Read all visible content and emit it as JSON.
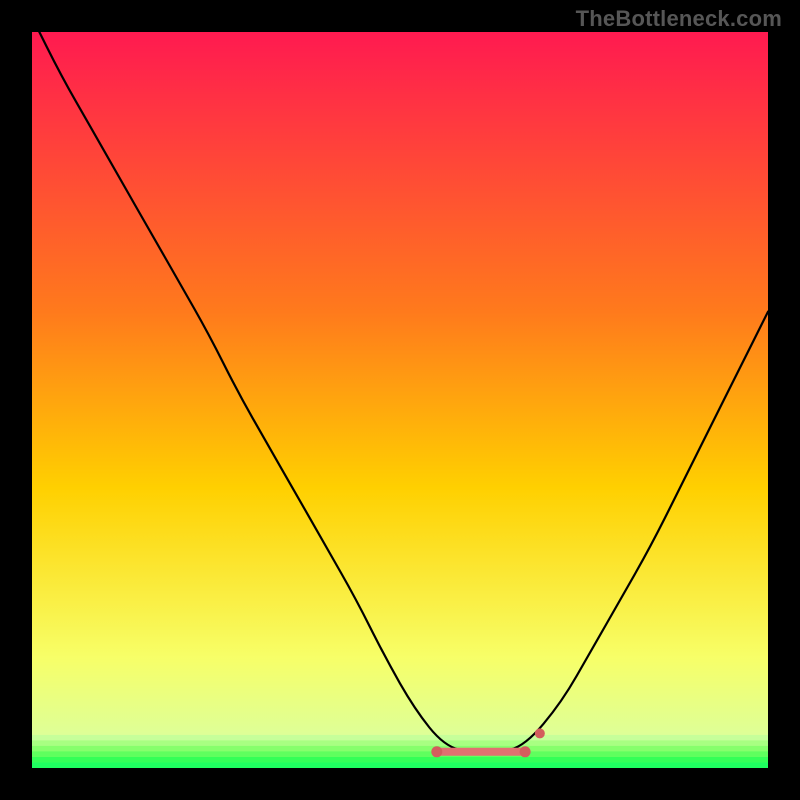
{
  "watermark": "TheBottleneck.com",
  "colors": {
    "top": "#ff1a50",
    "mid_top": "#ff7a1c",
    "mid": "#ffd000",
    "mid_low": "#f7ff68",
    "green": "#1fff60",
    "line": "#000000",
    "accent": "#e17070",
    "accent_dark": "#d35d5d",
    "bg": "#000000"
  },
  "chart_data": {
    "type": "line",
    "title": "",
    "xlabel": "",
    "ylabel": "",
    "xlim": [
      0,
      100
    ],
    "ylim": [
      0,
      100
    ],
    "x": [
      0,
      4,
      8,
      12,
      16,
      20,
      24,
      28,
      32,
      36,
      40,
      44,
      48,
      52,
      56,
      60,
      63,
      67,
      72,
      76,
      80,
      84,
      88,
      92,
      96,
      100
    ],
    "values": [
      102,
      94,
      87,
      80,
      73,
      66,
      59,
      51,
      44,
      37,
      30,
      23,
      15,
      8,
      3,
      2,
      2,
      3,
      9,
      16,
      23,
      30,
      38,
      46,
      54,
      62
    ],
    "flat_region": {
      "x_start": 55,
      "x_end": 67,
      "y": 2.2
    }
  }
}
